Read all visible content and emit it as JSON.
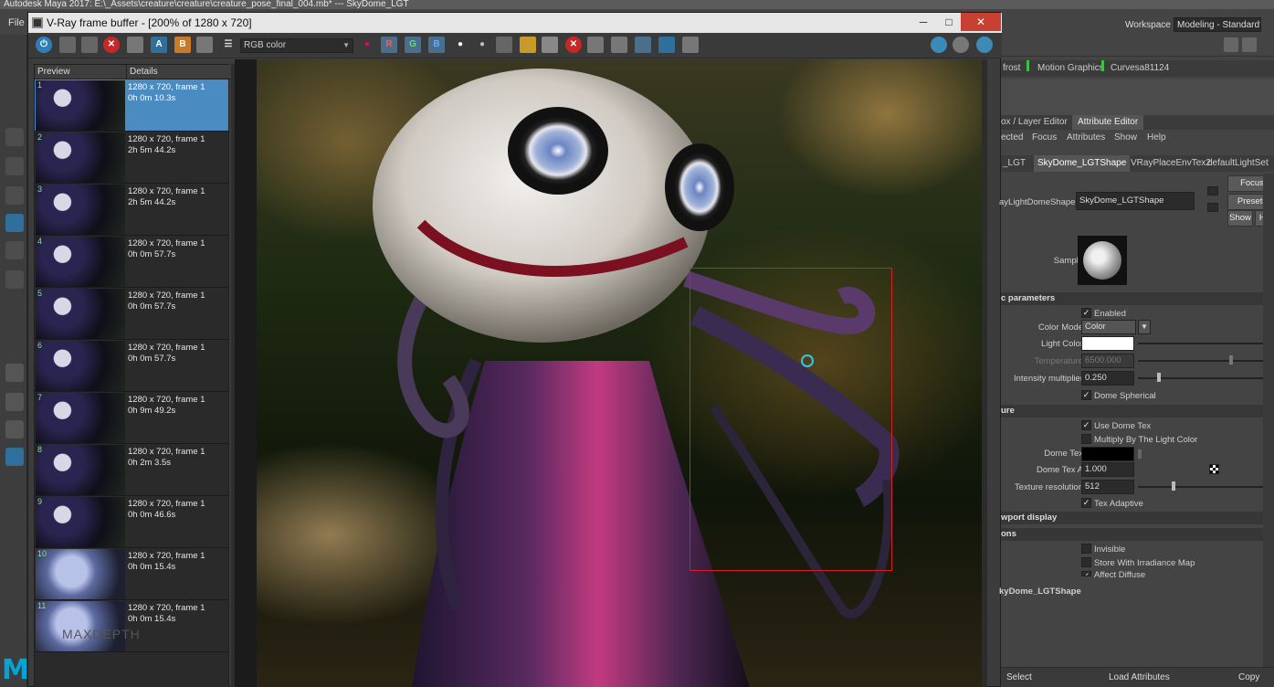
{
  "maya": {
    "title": "Autodesk Maya 2017: E:\\_Assets\\creature\\creature\\creature_pose_final_004.mb* --- SkyDome_LGT",
    "file_menu": "File",
    "workspace_label": "Workspace :",
    "workspace_value": "Modeling - Standard*",
    "logo": "M"
  },
  "vfb": {
    "title": "V-Ray frame buffer - [200% of 1280 x 720]",
    "channel": "RGB color",
    "minimize": "─",
    "maximize": "□",
    "close": "✕",
    "btn_r": "R",
    "btn_g": "G",
    "btn_b": "B",
    "btn_a": "A",
    "btn_b2": "B",
    "history_header": {
      "preview": "Preview",
      "details": "Details"
    },
    "history": [
      {
        "num": "1",
        "res": "1280 x 720, frame 1",
        "time": "0h 0m 10.3s"
      },
      {
        "num": "2",
        "res": "1280 x 720, frame 1",
        "time": "2h 5m 44.2s"
      },
      {
        "num": "3",
        "res": "1280 x 720, frame 1",
        "time": "2h 5m 44.2s"
      },
      {
        "num": "4",
        "res": "1280 x 720, frame 1",
        "time": "0h 0m 57.7s"
      },
      {
        "num": "5",
        "res": "1280 x 720, frame 1",
        "time": "0h 0m 57.7s"
      },
      {
        "num": "6",
        "res": "1280 x 720, frame 1",
        "time": "0h 0m 57.7s"
      },
      {
        "num": "7",
        "res": "1280 x 720, frame 1",
        "time": "0h 9m 49.2s"
      },
      {
        "num": "8",
        "res": "1280 x 720, frame 1",
        "time": "0h 2m 3.5s"
      },
      {
        "num": "9",
        "res": "1280 x 720, frame 1",
        "time": "0h 0m 46.6s"
      },
      {
        "num": "10",
        "res": "1280 x 720, frame 1",
        "time": "0h 0m 15.4s"
      },
      {
        "num": "11",
        "res": "1280 x 720, frame 1",
        "time": "0h 0m 15.4s"
      }
    ]
  },
  "attr": {
    "top_tabs": {
      "t1": "frost",
      "t2": "Motion Graphics",
      "t3": "Curvesa81124"
    },
    "editors": {
      "channel": "ox / Layer Editor",
      "attribute": "Attribute Editor"
    },
    "menu": {
      "m1": "ected",
      "m2": "Focus",
      "m3": "Attributes",
      "m4": "Show",
      "m5": "Help"
    },
    "nodes": {
      "n1": "_LGT",
      "n2": "SkyDome_LGTShape",
      "n3": "VRayPlaceEnvTex2",
      "n4": "defaultLightSet"
    },
    "node_label": "ayLightDomeShape:",
    "node_value": "SkyDome_LGTShape",
    "focus_btn": "Focus",
    "presets_btn": "Presets",
    "show_btn": "Show",
    "hide_btn": "Hid",
    "sample_label": "Sample",
    "section_basic": "c parameters",
    "enabled": "Enabled",
    "color_mode_label": "Color Mode",
    "color_mode_value": "Color",
    "light_color_label": "Light Color",
    "temperature_label": "Temperature",
    "temperature_value": "6500.000",
    "intensity_label": "Intensity multiplier",
    "intensity_value": "0.250",
    "dome_spherical": "Dome Spherical",
    "section_texture": "ure",
    "use_dome_tex": "Use Dome Tex",
    "multiply_light": "Multiply By The Light Color",
    "dome_tex_label": "Dome Tex",
    "dome_tex_a_label": "Dome Tex A",
    "dome_tex_a_value": "1.000",
    "tex_res_label": "Texture resolution",
    "tex_res_value": "512",
    "tex_adaptive": "Tex Adaptive",
    "section_viewport": "wport display",
    "section_options": "ons",
    "invisible": "Invisible",
    "store_irradiance": "Store With Irradiance Map",
    "affect_diffuse": "Affect Diffuse",
    "bottom_node": "kyDome_LGTShape",
    "select_btn": "Select",
    "load_attr_btn": "Load Attributes",
    "copy_tab_btn": "Copy Tab",
    "check": "✓"
  },
  "watermark": "MAXDEPTH",
  "colors": {
    "accent": "#4a8cc1",
    "region": "#d42020",
    "cursor": "#3ac4e0"
  }
}
